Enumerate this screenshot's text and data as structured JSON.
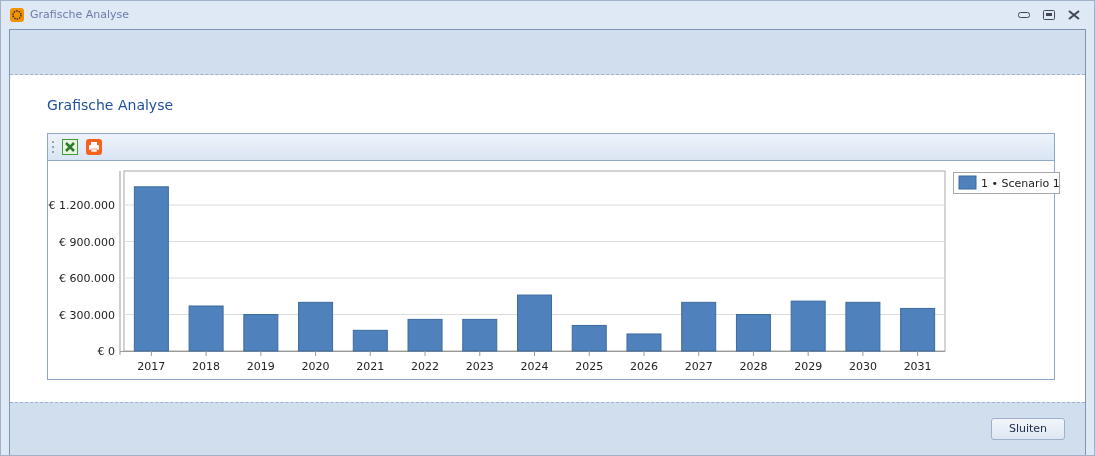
{
  "window": {
    "title": "Grafische Analyse"
  },
  "heading": "Grafische Analyse",
  "chart": {
    "chart_data": {
      "type": "bar",
      "categories": [
        "2017",
        "2018",
        "2019",
        "2020",
        "2021",
        "2022",
        "2023",
        "2024",
        "2025",
        "2026",
        "2027",
        "2028",
        "2029",
        "2030",
        "2031"
      ],
      "series": [
        {
          "name": "1 • Scenario 1",
          "color": "#4f81bd",
          "values": [
            1350000,
            370000,
            300000,
            400000,
            170000,
            260000,
            260000,
            460000,
            210000,
            140000,
            400000,
            300000,
            410000,
            400000,
            350000
          ]
        }
      ],
      "grid": true,
      "ylim": [
        0,
        1480000
      ],
      "yticks": [
        {
          "value": 0,
          "label": "€ 0"
        },
        {
          "value": 300000,
          "label": "€ 300.000"
        },
        {
          "value": 600000,
          "label": "€ 600.000"
        },
        {
          "value": 900000,
          "label": "€ 900.000"
        },
        {
          "value": 1200000,
          "label": "€ 1.200.000"
        }
      ]
    }
  },
  "buttons": [
    "Sluiten"
  ]
}
